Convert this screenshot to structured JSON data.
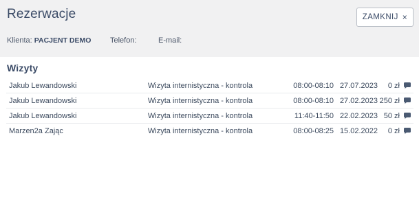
{
  "header": {
    "title": "Rezerwacje",
    "close_label": "ZAMKNIJ",
    "close_glyph": "×"
  },
  "info": {
    "client_label": "Klienta:",
    "client_value": "PACJENT DEMO",
    "phone_label": "Telefon:",
    "phone_value": "",
    "email_label": "E-mail:",
    "email_value": ""
  },
  "visits": {
    "title": "Wizyty",
    "rows": [
      {
        "name": "Jakub Lewandowski",
        "type": "Wizyta internistyczna - kontrola",
        "time": "08:00-08:10",
        "date": "27.07.2023",
        "price": "0 zł",
        "icon": "comment-icon"
      },
      {
        "name": "Jakub Lewandowski",
        "type": "Wizyta internistyczna - kontrola",
        "time": "08:00-08:10",
        "date": "27.02.2023",
        "price": "250 zł",
        "icon": "comment-icon"
      },
      {
        "name": "Jakub Lewandowski",
        "type": "Wizyta internistyczna - kontrola",
        "time": "11:40-11:50",
        "date": "22.02.2023",
        "price": "50 zł",
        "icon": "comment-icon"
      },
      {
        "name": "Marzen2a Zając",
        "type": "Wizyta internistyczna - kontrola",
        "time": "08:00-08:25",
        "date": "15.02.2022",
        "price": "0 zł",
        "icon": "comment-icon"
      }
    ]
  },
  "colors": {
    "header_bg": "#f1f1f2",
    "text": "#3b4b67",
    "icon": "#4a5a72"
  }
}
